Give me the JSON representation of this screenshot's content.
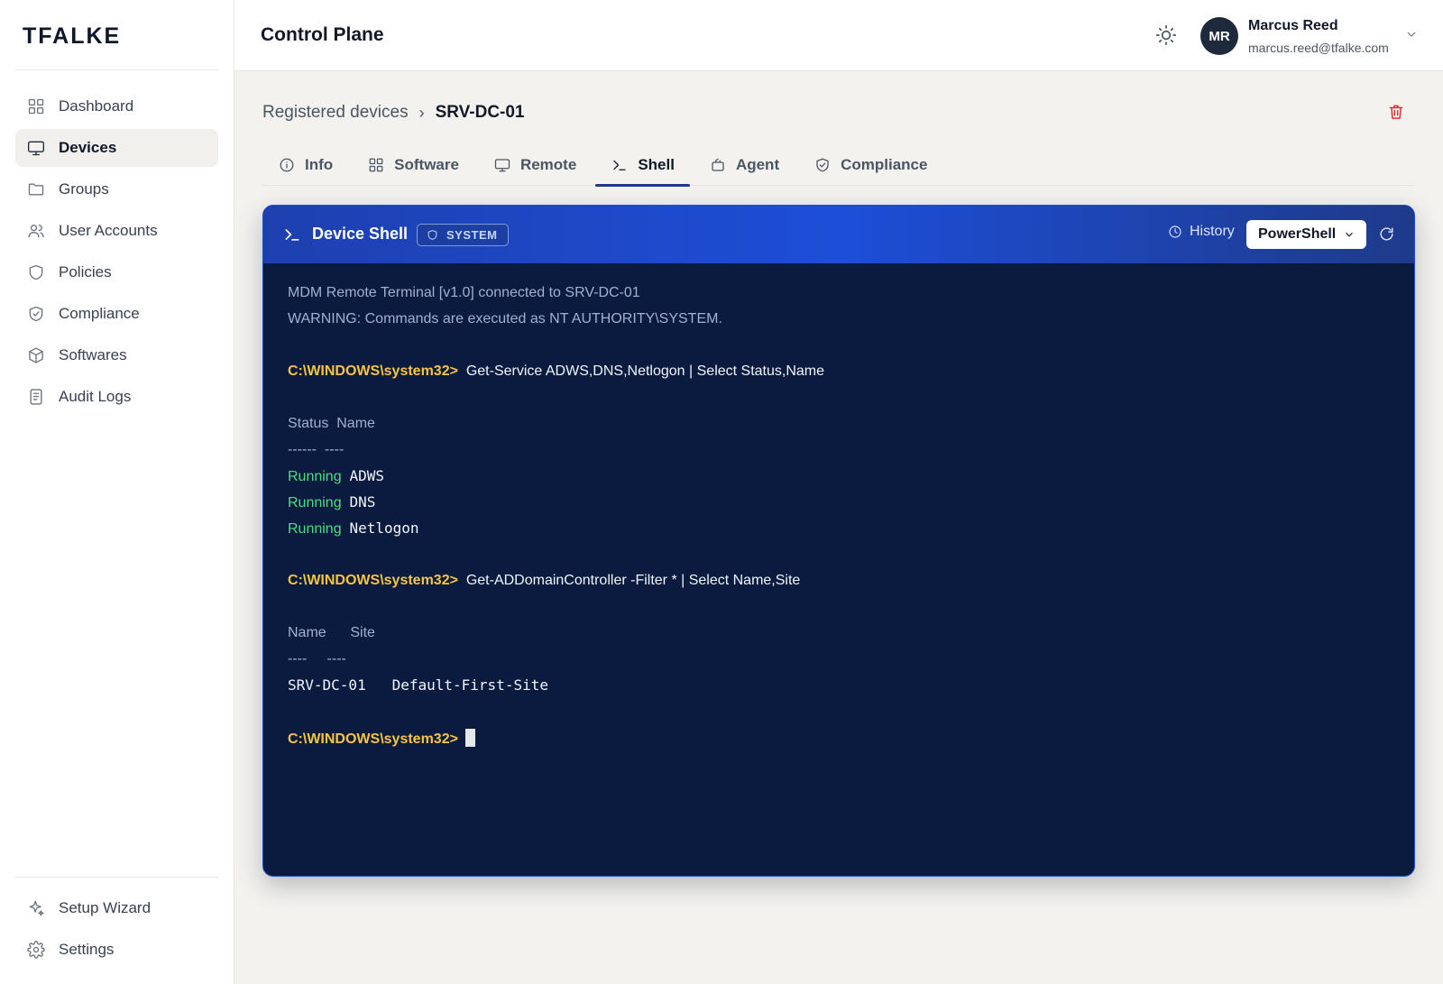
{
  "brand": "TFALKE",
  "sidebar": {
    "items": [
      {
        "label": "Dashboard",
        "icon": "grid-icon"
      },
      {
        "label": "Devices",
        "icon": "monitor-icon",
        "active": true
      },
      {
        "label": "Groups",
        "icon": "folder-icon"
      },
      {
        "label": "User Accounts",
        "icon": "users-icon"
      },
      {
        "label": "Policies",
        "icon": "shield-icon"
      },
      {
        "label": "Compliance",
        "icon": "shield-check-icon"
      },
      {
        "label": "Softwares",
        "icon": "package-icon"
      },
      {
        "label": "Audit Logs",
        "icon": "log-icon"
      }
    ],
    "bottom": [
      {
        "label": "Setup Wizard",
        "icon": "sparkles-icon"
      },
      {
        "label": "Settings",
        "icon": "gear-icon"
      }
    ]
  },
  "header": {
    "title": "Control Plane",
    "user": {
      "initials": "MR",
      "name": "Marcus Reed",
      "email": "marcus.reed@tfalke.com"
    }
  },
  "breadcrumb": {
    "parent": "Registered devices",
    "separator": "›",
    "current": "SRV-DC-01"
  },
  "tabs": [
    {
      "label": "Info",
      "icon": "info-icon"
    },
    {
      "label": "Software",
      "icon": "grid-icon"
    },
    {
      "label": "Remote",
      "icon": "monitor-icon"
    },
    {
      "label": "Shell",
      "icon": "terminal-icon",
      "active": true
    },
    {
      "label": "Agent",
      "icon": "agent-icon"
    },
    {
      "label": "Compliance",
      "icon": "shield-check-icon"
    }
  ],
  "shell": {
    "title": "Device Shell",
    "badge": "SYSTEM",
    "history_label": "History",
    "shell_type": "PowerShell",
    "banner": [
      "MDM Remote Terminal [v1.0] connected to SRV-DC-01",
      "WARNING: Commands are executed as NT AUTHORITY\\SYSTEM."
    ],
    "prompt": "C:\\WINDOWS\\system32>",
    "cmd1": "Get-Service ADWS,DNS,Netlogon | Select Status,Name",
    "table1": {
      "header": "Status  Name",
      "rule": "------  ----",
      "rows": [
        {
          "status": "Running",
          "name": "ADWS"
        },
        {
          "status": "Running",
          "name": "DNS"
        },
        {
          "status": "Running",
          "name": "Netlogon"
        }
      ]
    },
    "cmd2": "Get-ADDomainController -Filter * | Select Name,Site",
    "table2": {
      "header": "Name      Site",
      "rule": "----     ----",
      "row": "SRV-DC-01   Default-First-Site"
    }
  },
  "colors": {
    "accent": "#1e3a8a",
    "terminal_bg": "#0b1b3f",
    "prompt": "#f5c542",
    "running": "#4ade80",
    "danger": "#dc2626"
  }
}
